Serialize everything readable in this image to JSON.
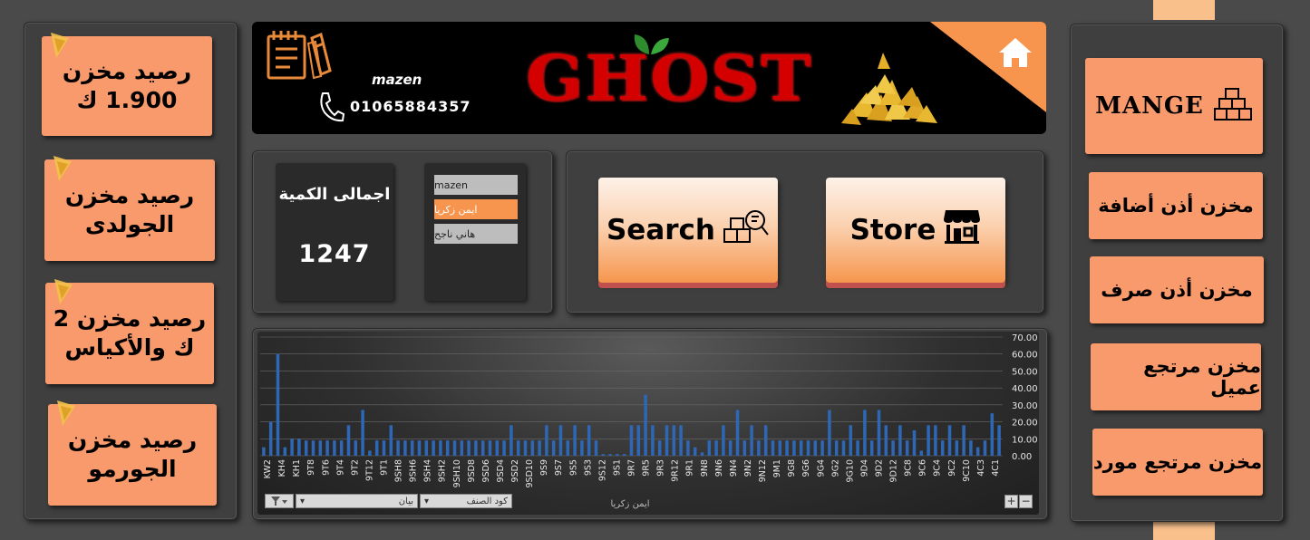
{
  "left_panel": {
    "buttons": [
      {
        "line1": "رصيد مخزن",
        "line2": "1.900 ك"
      },
      {
        "line1": "رصيد مخزن",
        "line2": "الجولدى"
      },
      {
        "line1": "رصيد مخزن 2",
        "line2": "ك والأكياس"
      },
      {
        "line1": "رصيد مخزن",
        "line2": "الجورمو"
      }
    ]
  },
  "right_panel": {
    "manage_label": "MANGE",
    "buttons": [
      "مخزن أذن أضافة",
      "مخزن أذن صرف",
      "مخزن مرتجع عميل",
      "مخزن مرتجع مورد"
    ]
  },
  "banner": {
    "name": "mazen",
    "phone": "01065884357",
    "brand": "GHOST"
  },
  "summary": {
    "total_label": "اجمالى الكمية",
    "total_value": "1247"
  },
  "slicer": {
    "items": [
      {
        "label": "mazen",
        "selected": false
      },
      {
        "label": "ايمن زكريا",
        "selected": true
      },
      {
        "label": "هاني ناجح",
        "selected": false
      }
    ]
  },
  "actions": {
    "search_label": "Search",
    "store_label": "Store"
  },
  "chart_data": {
    "type": "bar",
    "series_color": "#2e67b5",
    "ylim": [
      0,
      70
    ],
    "y_ticks": [
      "0.00",
      "10.00",
      "20.00",
      "30.00",
      "40.00",
      "50.00",
      "60.00",
      "70.00"
    ],
    "y_axis_position": "right",
    "grid": true,
    "x_labels": [
      "KW2",
      "KH4",
      "KH1",
      "9T8",
      "9T6",
      "9T4",
      "9T2",
      "9T12",
      "9T1",
      "9SH8",
      "9SH6",
      "9SH4",
      "9SH2",
      "9SH10",
      "9SD8",
      "9SD6",
      "9SD4",
      "9SD2",
      "9SD10",
      "9S9",
      "9S7",
      "9S5",
      "9S3",
      "9S12",
      "9S1",
      "9R7",
      "9R5",
      "9R3",
      "9R12",
      "9R1",
      "9N8",
      "9N6",
      "9N4",
      "9N2",
      "9N12",
      "9M1",
      "9G8",
      "9G6",
      "9G4",
      "9G2",
      "9G10",
      "9D4",
      "9D2",
      "9D12",
      "9C8",
      "9C6",
      "9C4",
      "9C2",
      "9C10",
      "4C3",
      "4C1"
    ],
    "values": [
      5,
      20,
      60,
      5,
      10,
      10,
      9,
      9,
      9,
      9,
      9,
      9,
      18,
      9,
      27,
      3,
      9,
      9,
      18,
      9,
      9,
      9,
      9,
      9,
      9,
      9,
      9,
      9,
      9,
      9,
      9,
      9,
      9,
      9,
      9,
      18,
      9,
      9,
      9,
      9,
      18,
      9,
      18,
      9,
      18,
      9,
      18,
      9,
      1,
      1,
      1,
      1,
      18,
      18,
      36,
      18,
      9,
      18,
      18,
      18,
      9,
      5,
      2,
      9,
      9,
      18,
      9,
      27,
      9,
      18,
      9,
      18,
      9,
      9,
      9,
      9,
      9,
      9,
      9,
      9,
      27,
      9,
      9,
      18,
      9,
      27,
      9,
      27,
      18,
      9,
      18,
      9,
      15,
      3,
      18,
      18,
      9,
      18,
      9,
      18,
      9,
      5,
      9,
      25,
      18
    ],
    "filters": [
      "بيان",
      "كود الصنف"
    ],
    "caption": "ايمن زكريا"
  }
}
